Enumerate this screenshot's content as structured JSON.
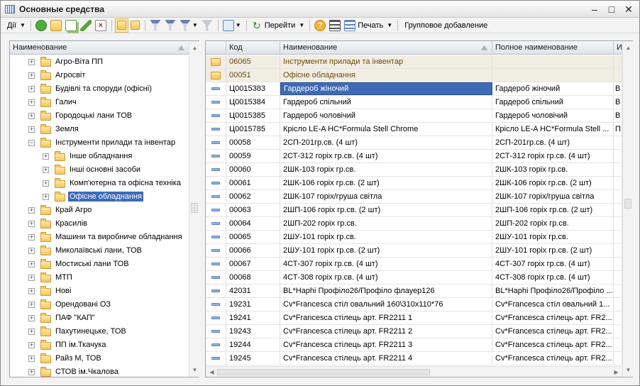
{
  "window": {
    "title": "Основные средства"
  },
  "toolbar": {
    "actions_label": "Дії",
    "goto_label": "Перейти",
    "print_label": "Печать",
    "group_add_label": "Групповое добавление"
  },
  "tree": {
    "header": "Наименование",
    "items": [
      {
        "label": "Агро-Віта ПП",
        "level": 0,
        "expanded": false,
        "selected": false
      },
      {
        "label": "Агросвіт",
        "level": 0,
        "expanded": false,
        "selected": false
      },
      {
        "label": "Будівлі та споруди (офісні)",
        "level": 0,
        "expanded": false,
        "selected": false
      },
      {
        "label": "Галич",
        "level": 0,
        "expanded": false,
        "selected": false
      },
      {
        "label": "Городоцькі лани ТОВ",
        "level": 0,
        "expanded": false,
        "selected": false
      },
      {
        "label": "Земля",
        "level": 0,
        "expanded": false,
        "selected": false
      },
      {
        "label": "Інструменти прилади та інвентар",
        "level": 0,
        "expanded": true,
        "selected": false
      },
      {
        "label": "Інше обладнання",
        "level": 1,
        "expanded": false,
        "selected": false
      },
      {
        "label": "Інші основні засоби",
        "level": 1,
        "expanded": false,
        "selected": false
      },
      {
        "label": "Комп'ютерна та офісна техніка",
        "level": 1,
        "expanded": false,
        "selected": false
      },
      {
        "label": "Офісне обладнання",
        "level": 1,
        "expanded": false,
        "selected": true
      },
      {
        "label": "Край Агро",
        "level": 0,
        "expanded": false,
        "selected": false
      },
      {
        "label": "Красилів",
        "level": 0,
        "expanded": false,
        "selected": false
      },
      {
        "label": "Машини та виробниче обладнання",
        "level": 0,
        "expanded": false,
        "selected": false
      },
      {
        "label": "Миколаївські лани, ТОВ",
        "level": 0,
        "expanded": false,
        "selected": false
      },
      {
        "label": "Мостиські лани ТОВ",
        "level": 0,
        "expanded": false,
        "selected": false
      },
      {
        "label": "МТП",
        "level": 0,
        "expanded": false,
        "selected": false
      },
      {
        "label": "Нові",
        "level": 0,
        "expanded": false,
        "selected": false
      },
      {
        "label": "Орендовані ОЗ",
        "level": 0,
        "expanded": false,
        "selected": false
      },
      {
        "label": "ПАФ \"КАП\"",
        "level": 0,
        "expanded": false,
        "selected": false
      },
      {
        "label": "Пахутинецьке, ТОВ",
        "level": 0,
        "expanded": false,
        "selected": false
      },
      {
        "label": "ПП ім.Ткачука",
        "level": 0,
        "expanded": false,
        "selected": false
      },
      {
        "label": "Райз М, ТОВ",
        "level": 0,
        "expanded": false,
        "selected": false
      },
      {
        "label": "СТОВ ім.Чкалова",
        "level": 0,
        "expanded": false,
        "selected": false
      }
    ]
  },
  "grid": {
    "columns": {
      "code": "Код",
      "name": "Наименование",
      "full": "Полное наименование",
      "extra": "И"
    },
    "rows": [
      {
        "type": "group",
        "code": "06065",
        "name": "Інструменти прилади та інвентар",
        "full": "",
        "extra": ""
      },
      {
        "type": "group",
        "code": "00051",
        "name": "Офісне обладнання",
        "full": "",
        "extra": ""
      },
      {
        "type": "item",
        "code": "Ц0015383",
        "name": "Гардероб жіночий",
        "full": "Гардероб жіночий",
        "extra": "В",
        "selected": true
      },
      {
        "type": "item",
        "code": "Ц0015384",
        "name": "Гардероб спільний",
        "full": "Гардероб спільний",
        "extra": "В"
      },
      {
        "type": "item",
        "code": "Ц0015385",
        "name": "Гардероб чоловічий",
        "full": "Гардероб чоловічий",
        "extra": "В"
      },
      {
        "type": "item",
        "code": "Ц0015785",
        "name": "Крісло LE-A HC*Formula Stell Chrome",
        "full": "Крісло LE-A HC*Formula Stell ...",
        "extra": "П"
      },
      {
        "type": "item",
        "code": "00058",
        "name": "2СП-201гр.св. (4 шт)",
        "full": "2СП-201гр.св. (4 шт)",
        "extra": ""
      },
      {
        "type": "item",
        "code": "00059",
        "name": "2СТ-312 горіх гр.св. (4 шт)",
        "full": "2СТ-312 горіх гр.св. (4 шт)",
        "extra": ""
      },
      {
        "type": "item",
        "code": "00060",
        "name": "2ШК-103 горіх гр.св.",
        "full": "2ШК-103 горіх гр.св.",
        "extra": ""
      },
      {
        "type": "item",
        "code": "00061",
        "name": "2ШК-106 горіх гр.св. (2 шт)",
        "full": "2ШК-106 горіх гр.св. (2 шт)",
        "extra": ""
      },
      {
        "type": "item",
        "code": "00062",
        "name": "2ШК-107 горіх/груша світла",
        "full": "2ШК-107 горіх/груша світла",
        "extra": ""
      },
      {
        "type": "item",
        "code": "00063",
        "name": "2ШП-106 горіх гр.св. (2 шт)",
        "full": "2ШП-106 горіх гр.св. (2 шт)",
        "extra": ""
      },
      {
        "type": "item",
        "code": "00064",
        "name": "2ШП-202 горіх гр.св.",
        "full": "2ШП-202 горіх гр.св.",
        "extra": ""
      },
      {
        "type": "item",
        "code": "00065",
        "name": "2ШУ-101 горіх гр.св.",
        "full": "2ШУ-101 горіх гр.св.",
        "extra": ""
      },
      {
        "type": "item",
        "code": "00066",
        "name": "2ШУ-101 горіх гр.св. (2 шт)",
        "full": "2ШУ-101 горіх гр.св. (2 шт)",
        "extra": ""
      },
      {
        "type": "item",
        "code": "00067",
        "name": "4СТ-307 горіх гр.св. (4 шт)",
        "full": "4СТ-307 горіх гр.св. (4 шт)",
        "extra": ""
      },
      {
        "type": "item",
        "code": "00068",
        "name": "4СТ-308 горіх гр.св. (4 шт)",
        "full": "4СТ-308 горіх гр.св. (4 шт)",
        "extra": ""
      },
      {
        "type": "item",
        "code": "42031",
        "name": "BL*Наphi Профіло26/Профіло флауер126",
        "full": "BL*Наphi Профіло26/Профіло ...",
        "extra": ""
      },
      {
        "type": "item",
        "code": "19231",
        "name": "Cv*Francesca стіл овальний 160\\310x110*76",
        "full": "Cv*Francesca стіл овальний 1...",
        "extra": ""
      },
      {
        "type": "item",
        "code": "19241",
        "name": "Cv*Francesca стілець арт. FR2211 1",
        "full": "Cv*Francesca стілець арт. FR2...",
        "extra": ""
      },
      {
        "type": "item",
        "code": "19243",
        "name": "Cv*Francesca стілець арт. FR2211 2",
        "full": "Cv*Francesca стілець арт. FR2...",
        "extra": ""
      },
      {
        "type": "item",
        "code": "19244",
        "name": "Cv*Francesca стілець арт. FR2211 3",
        "full": "Cv*Francesca стілець арт. FR2...",
        "extra": ""
      },
      {
        "type": "item",
        "code": "19245",
        "name": "Cv*Francesca стілець арт. FR2211 4",
        "full": "Cv*Francesca стілець арт. FR2...",
        "extra": ""
      }
    ]
  },
  "colors": {
    "selection": "#3d6bb6",
    "group_row": "#f2ede2",
    "panel_border": "#9ca6b4"
  },
  "icons": [
    "table-icon",
    "minimize-icon",
    "maximize-icon",
    "close-icon",
    "add-icon",
    "add-group-icon",
    "copy-icon",
    "edit-icon",
    "delete-icon",
    "hierarchy-icon",
    "level-up-icon",
    "filter-icon",
    "filter-select-icon",
    "filter-dropdown-icon",
    "filter-clear-icon",
    "goto-icon",
    "refresh-icon",
    "help-icon",
    "list-settings-icon",
    "columns-icon",
    "folder-icon",
    "item-icon",
    "sort-icon"
  ]
}
